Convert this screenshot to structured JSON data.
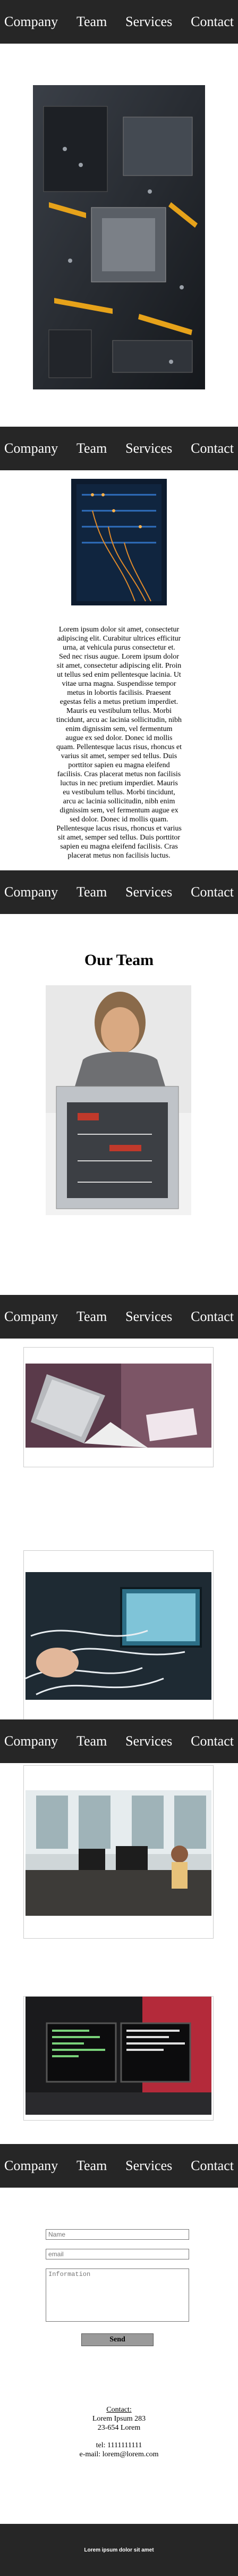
{
  "nav": {
    "company": "Company",
    "team": "Team",
    "services": "Services",
    "contact": "Contact"
  },
  "about": {
    "paragraph": "Lorem ipsum dolor sit amet, consectetur adipiscing elit. Curabitur ultrices efficitur urna, at vehicula purus consectetur et. Sed nec risus augue. Lorem ipsum dolor sit amet, consectetur adipiscing elit. Proin ut tellus sed enim pellentesque lacinia. Ut vitae urna magna. Suspendisse tempor metus in lobortis facilisis. Praesent egestas felis a metus pretium imperdiet. Mauris eu vestibulum tellus. Morbi tincidunt, arcu ac lacinia sollicitudin, nibh enim dignissim sem, vel fermentum augue ex sed dolor. Donec id mollis quam. Pellentesque lacus risus, rhoncus et varius sit amet, semper sed tellus. Duis porttitor sapien eu magna eleifend facilisis. Cras placerat metus non facilisis luctus in nec pretium imperdiet. Mauris eu vestibulum tellus. Morbi tincidunt, arcu ac lacinia sollicitudin, nibh enim dignissim sem, vel fermentum augue ex sed dolor. Donec id mollis quam. Pellentesque lacus risus, rhoncus et varius sit amet, semper sed tellus. Duis porttitor sapien eu magna eleifend facilisis. Cras placerat metus non facilisis luctus."
  },
  "team": {
    "title": "Our Team"
  },
  "form": {
    "name_placeholder": "Name",
    "email_placeholder": "email",
    "info_placeholder": "Information",
    "send_label": "Send"
  },
  "contact": {
    "heading": "Contact:",
    "line1": "Lorem Ipsum 283",
    "line2": "23-654 Lorem",
    "tel": "tel: 1111111111",
    "email": "e-mail: lorem@lorem.com"
  },
  "footer": {
    "text": "Lorem ipsum dolor sit amet"
  }
}
